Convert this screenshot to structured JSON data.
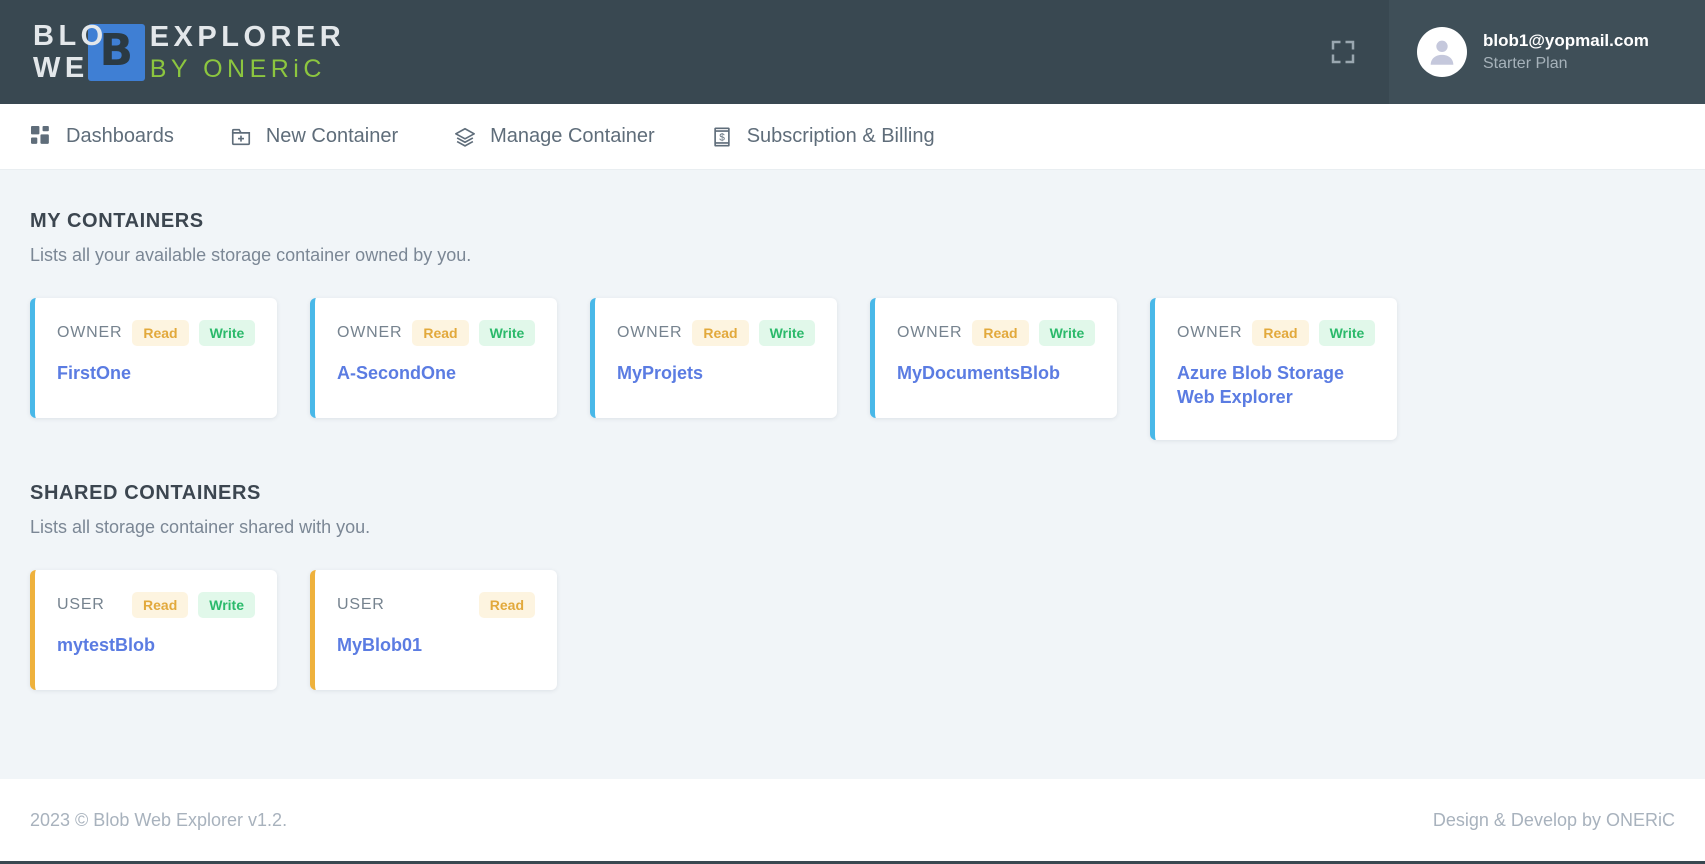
{
  "brand": {
    "logo_line1_left": "BLO",
    "logo_line2_left": "WE",
    "logo_mark_letter": "B",
    "logo_line1_right": "EXPLORER",
    "logo_line2_right": "BY ONERiC",
    "accent_blue": "#3f7fd4",
    "accent_green": "#8cc63f",
    "topbar_bg": "#394851",
    "userpanel_bg": "#3f4f58"
  },
  "topbar": {
    "fullscreen_icon": "fullscreen-icon",
    "user": {
      "avatar_icon": "user-avatar-icon",
      "email": "blob1@yopmail.com",
      "plan": "Starter Plan"
    }
  },
  "nav": {
    "items": [
      {
        "label": "Dashboards",
        "icon": "dashboard-grid-icon"
      },
      {
        "label": "New Container",
        "icon": "add-box-icon"
      },
      {
        "label": "Manage Container",
        "icon": "layers-icon"
      },
      {
        "label": "Subscription & Billing",
        "icon": "receipt-dollar-icon"
      }
    ]
  },
  "sections": [
    {
      "title": "MY CONTAINERS",
      "subtitle": "Lists all your available storage container owned by you.",
      "accent": "#49b8e8",
      "cards": [
        {
          "role": "OWNER",
          "name": "FirstOne",
          "permissions": [
            "Read",
            "Write"
          ]
        },
        {
          "role": "OWNER",
          "name": "A-SecondOne",
          "permissions": [
            "Read",
            "Write"
          ]
        },
        {
          "role": "OWNER",
          "name": "MyProjets",
          "permissions": [
            "Read",
            "Write"
          ]
        },
        {
          "role": "OWNER",
          "name": "MyDocumentsBlob",
          "permissions": [
            "Read",
            "Write"
          ]
        },
        {
          "role": "OWNER",
          "name": "Azure Blob Storage Web Explorer",
          "permissions": [
            "Read",
            "Write"
          ]
        }
      ]
    },
    {
      "title": "SHARED CONTAINERS",
      "subtitle": "Lists all storage container shared with you.",
      "accent": "#eeb13c",
      "cards": [
        {
          "role": "USER",
          "name": "mytestBlob",
          "permissions": [
            "Read",
            "Write"
          ]
        },
        {
          "role": "USER",
          "name": "MyBlob01",
          "permissions": [
            "Read"
          ]
        }
      ]
    }
  ],
  "footer": {
    "left": "2023 © Blob Web Explorer v1.2.",
    "right": "Design & Develop by ONERiC"
  }
}
